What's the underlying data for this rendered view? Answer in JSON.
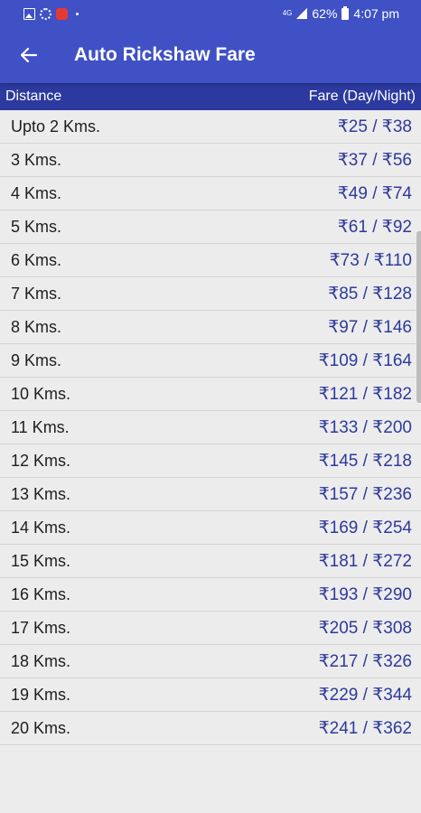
{
  "status_bar": {
    "signal_label": "4G",
    "battery": "62%",
    "time": "4:07 pm"
  },
  "app_bar": {
    "title": "Auto Rickshaw Fare"
  },
  "table": {
    "headers": [
      "Distance",
      "Fare (Day/Night)"
    ],
    "rows": [
      {
        "distance": "Upto 2 Kms.",
        "fare": "₹25 / ₹38"
      },
      {
        "distance": "3 Kms.",
        "fare": "₹37 / ₹56"
      },
      {
        "distance": "4 Kms.",
        "fare": "₹49 / ₹74"
      },
      {
        "distance": "5 Kms.",
        "fare": "₹61 / ₹92"
      },
      {
        "distance": "6 Kms.",
        "fare": "₹73 / ₹110"
      },
      {
        "distance": "7 Kms.",
        "fare": "₹85 / ₹128"
      },
      {
        "distance": "8 Kms.",
        "fare": "₹97 / ₹146"
      },
      {
        "distance": "9 Kms.",
        "fare": "₹109 / ₹164"
      },
      {
        "distance": "10 Kms.",
        "fare": "₹121 / ₹182"
      },
      {
        "distance": "11 Kms.",
        "fare": "₹133 / ₹200"
      },
      {
        "distance": "12 Kms.",
        "fare": "₹145 / ₹218"
      },
      {
        "distance": "13 Kms.",
        "fare": "₹157 / ₹236"
      },
      {
        "distance": "14 Kms.",
        "fare": "₹169 / ₹254"
      },
      {
        "distance": "15 Kms.",
        "fare": "₹181 / ₹272"
      },
      {
        "distance": "16 Kms.",
        "fare": "₹193 / ₹290"
      },
      {
        "distance": "17 Kms.",
        "fare": "₹205 / ₹308"
      },
      {
        "distance": "18 Kms.",
        "fare": "₹217 / ₹326"
      },
      {
        "distance": "19 Kms.",
        "fare": "₹229 / ₹344"
      },
      {
        "distance": "20 Kms.",
        "fare": "₹241 / ₹362"
      }
    ]
  },
  "colors": {
    "primary": "#3f51c4",
    "header_dark": "#2c3a9f",
    "fare_text": "#2e3a9c",
    "background": "#ececec"
  }
}
